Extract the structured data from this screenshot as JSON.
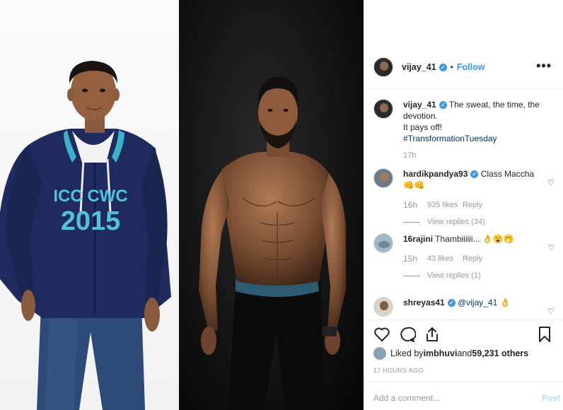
{
  "post": {
    "author": "vijay_41",
    "follow_label": "Follow",
    "more_label": "•••",
    "dot": "•",
    "caption": {
      "username": "vijay_41",
      "text_line1": "The sweat, the time, the",
      "text_line2": "devotion.",
      "text_line3": "It pays off!",
      "hashtag": "#TransformationTuesday",
      "time": "17h"
    }
  },
  "image": {
    "hoodie_text1": "ICC CWC",
    "hoodie_text2": "2015"
  },
  "comments": [
    {
      "username": "hardikpandya93",
      "text": "Class Maccha",
      "emoji": "👊👊",
      "time": "16h",
      "likes": "935 likes",
      "reply": "Reply",
      "view_replies": "View replies (34)"
    },
    {
      "username": "16rajini",
      "text": "Thambiiiiii...",
      "emoji": "👌😮🤭",
      "time": "15h",
      "likes": "43 likes",
      "reply": "Reply",
      "view_replies": "View replies (1)"
    },
    {
      "username": "shreyas41",
      "mention": "@vijay_41",
      "emoji": "👌"
    }
  ],
  "liked_by": {
    "prefix": "Liked by ",
    "user": "imbhuvi",
    "middle": " and ",
    "count": "59,231 others"
  },
  "timestamp": "17 HOURS AGO",
  "add_comment": {
    "placeholder": "Add a comment...",
    "post_label": "Post"
  },
  "colors": {
    "link_blue": "#3897f0",
    "hashtag": "#003569",
    "muted": "#999999",
    "hoodie_navy": "#1f2b5e",
    "hoodie_text": "#4dc4d8"
  }
}
